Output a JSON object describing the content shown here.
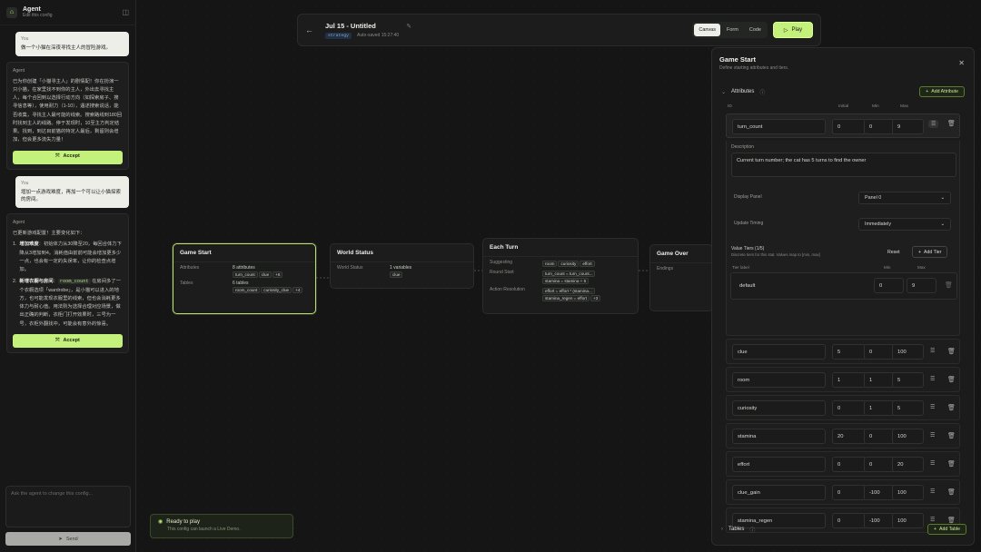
{
  "agent": {
    "title": "Agent",
    "subtitle": "Edit this config",
    "messages": [
      {
        "role": "You",
        "text": "做一个小猫在深夜寻找主人的冒险游戏。"
      },
      {
        "role": "Agent",
        "text": "已为你创建「小猫寻主人」的剧情配！你在扮演一只小猫，在家里找不到你的主人，外出去寻找主人，每个合回到以选择行动方向（如探索房子、搜寻信息等），使用耐力（1-10），遇述搜索说话，能否收集，寻找主人最可能的线索。搜索路线到180回时找到主人的线路。停于发现时，10至主方判定结果。找到，到达目前猫的特定人最后，剩留则会增加，但会更多流失力量！"
      },
      {
        "role": "You",
        "text": "增加一点游戏难度，再加一个可以让小猫探索的房间。"
      },
      {
        "role": "Agent",
        "text": "已更新游戏配置！主要变化如下："
      }
    ],
    "list_items": [
      {
        "num": "1.",
        "title": "增加难度",
        "text": "初始体力从30降至20，每回合体力下降从3增加到4。消耗值由前前可能会增加更多少一点，也会有一定的失误率，让你的检查点增加。"
      },
      {
        "num": "2.",
        "title": "新增衣橱与房间",
        "text": "在房间多了一个衣橱选项「wardrobe」，是小猫可以进入的地方，也可能发现衣服里的线索，但也会消耗更多体力与耐心值。用法则为选择合理对应场景，做出正确的判断，衣柜门打开效果时，三号为一号，衣柜外翻找中，可能会有意外的惊喜。"
      }
    ],
    "code_chip": "room_count",
    "accept_label": "Accept",
    "input_placeholder": "Ask the agent to change this config...",
    "send_label": "Send"
  },
  "topbar": {
    "title": "Jul 15 - Untitled",
    "tag": "strategy",
    "autosave": "Auto-saved 15:27:40",
    "tabs": [
      "Canvas",
      "Form",
      "Code"
    ],
    "active_tab": "Canvas",
    "play_label": "Play"
  },
  "nodes": {
    "game_start": {
      "title": "Game Start",
      "attr_label": "Attributes",
      "attr_count": "8 attributes",
      "attr_pills": [
        "turn_count",
        "clue",
        "+6"
      ],
      "tables_label": "Tables",
      "tables_count": "6 tables",
      "table_pills": [
        "room_count",
        "curiosity_clue",
        "+4"
      ]
    },
    "world_status": {
      "title": "World Status",
      "label": "World Status",
      "count": "1 variables",
      "pills": [
        "clue"
      ]
    },
    "each_turn": {
      "title": "Each Turn",
      "suggesting_label": "Suggesting",
      "suggesting_pills": [
        "room",
        "curiosity",
        "effort"
      ],
      "round_label": "Round Start",
      "round_pills": [
        "turn_count = turn_count...",
        "stamina = stamina + 6"
      ],
      "action_label": "Action Resolution",
      "action_pills": [
        "effort = effort * (stamina...",
        "stamina_regen = effort",
        "+3"
      ]
    },
    "game_over": {
      "title": "Game Over",
      "endings_label": "Endings"
    }
  },
  "ready": {
    "title": "Ready to play",
    "subtitle": "This config can launch a Live Demo."
  },
  "panel": {
    "title": "Game Start",
    "subtitle": "Define starting attributes and tiers.",
    "attributes_label": "Attributes",
    "add_attribute": "Add Attribute",
    "columns": {
      "id": "ID",
      "initial": "Initial",
      "min": "Min",
      "max": "Max"
    },
    "expanded": {
      "id": "turn_count",
      "initial": "0",
      "min": "0",
      "max": "9",
      "description_label": "Description",
      "description": "Current turn number; the cat has 5 turns to find the owner",
      "display_panel_label": "Display Panel",
      "display_panel": "Panel 0",
      "update_timing_label": "Update Timing",
      "update_timing": "Immediately",
      "value_tiers_label": "Value Tiers (1/5)",
      "value_tiers_hint": "Discrete tiers for this stat. Values map to [min, max]",
      "reset_label": "Reset",
      "add_tier_label": "Add Tier",
      "tier_cols": {
        "label": "Tier label",
        "min": "Min",
        "max": "Max"
      },
      "tier": {
        "label": "default",
        "min": "0",
        "max": "9"
      }
    },
    "attributes": [
      {
        "id": "clue",
        "initial": "5",
        "min": "0",
        "max": "100"
      },
      {
        "id": "room",
        "initial": "1",
        "min": "1",
        "max": "5"
      },
      {
        "id": "curiosity",
        "initial": "0",
        "min": "1",
        "max": "5"
      },
      {
        "id": "stamina",
        "initial": "20",
        "min": "0",
        "max": "100"
      },
      {
        "id": "effort",
        "initial": "0",
        "min": "0",
        "max": "20"
      },
      {
        "id": "clue_gain",
        "initial": "0",
        "min": "-100",
        "max": "100"
      },
      {
        "id": "stamina_regen",
        "initial": "0",
        "min": "-100",
        "max": "100"
      }
    ],
    "tables_label": "Tables",
    "add_table": "Add Table"
  }
}
